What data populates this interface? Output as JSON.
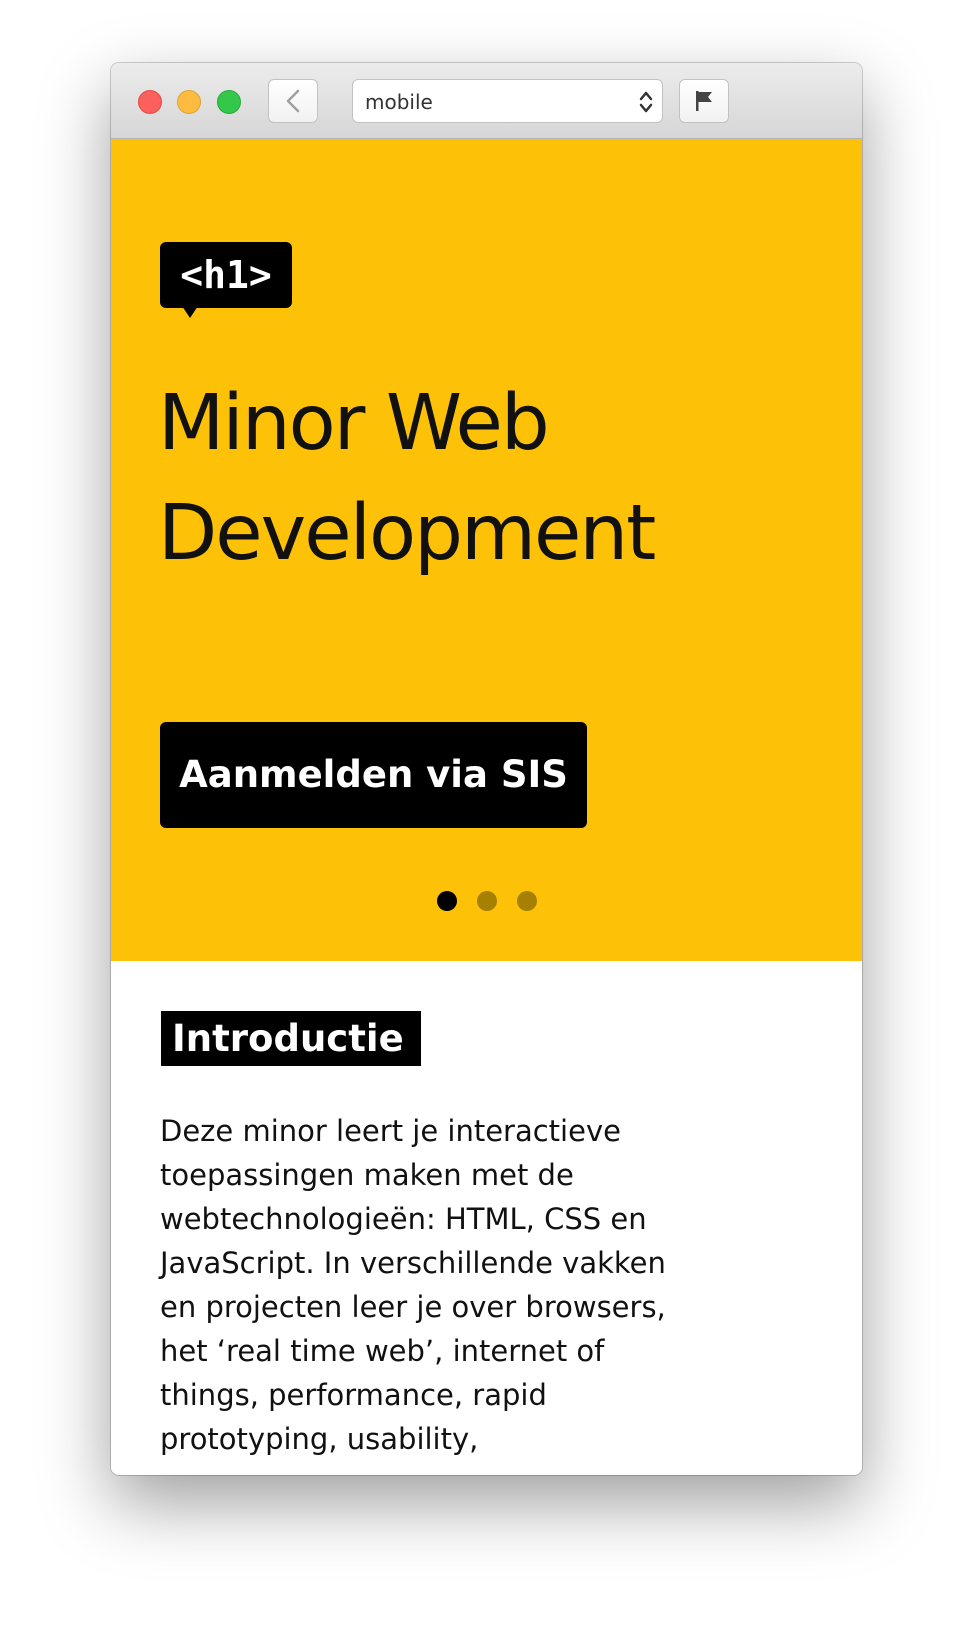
{
  "browser": {
    "address_value": "mobile",
    "icons": [
      "back-chevron-icon",
      "select-arrows-icon",
      "flag-icon"
    ]
  },
  "hero": {
    "badge_text": "<h1>",
    "title": "Minor Web Development",
    "cta_label": "Aanmelden via SIS",
    "carousel": {
      "total": 3,
      "active_index": 1
    },
    "background_color": "#fdc107"
  },
  "intro": {
    "heading": "Introductie",
    "text": "Deze minor leert je interactieve toepassingen maken met de webtechnologieën: HTML, CSS en JavaScript. In verschillende vakken en projecten leer je over browsers, het ‘real time web’, internet of things, performance, rapid prototyping, usability,"
  }
}
